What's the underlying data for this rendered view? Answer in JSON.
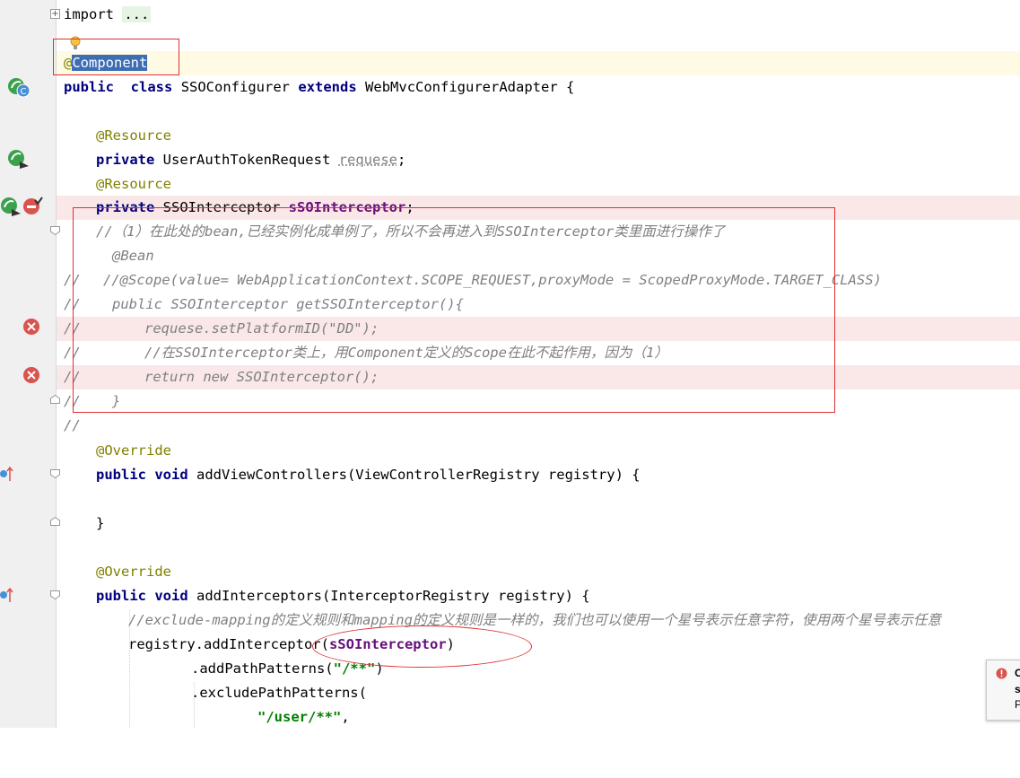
{
  "editor": {
    "lines": {
      "import_kw": "import",
      "import_fold": "...",
      "component_at": "@",
      "component_name": "Component",
      "class_kw1": "public",
      "class_kw2": "class",
      "class_name": "SSOConfigurer",
      "extends_kw": "extends",
      "parent": "WebMvcConfigurerAdapter {",
      "resource1": "@Resource",
      "private1": "private",
      "type1": "UserAuthTokenRequest",
      "field1": "requese",
      "semi1": ";",
      "resource2": "@Resource",
      "private2": "private",
      "type2": "SSOInterceptor",
      "field2": "sSOInterceptor",
      "semi2": ";",
      "c1": "//（1）在此处的bean,已经实例化成单例了，所以不会再进入到SSOInterceptor类里面进行操作了",
      "c2": "@Bean",
      "c3": "//@Scope(value= WebApplicationContext.SCOPE_REQUEST,proxyMode = ScopedProxyMode.TARGET_CLASS)",
      "c4": "public SSOInterceptor getSSOInterceptor(){",
      "c5": "requese.setPlatformID(\"DD\");",
      "c6": "//在SSOInterceptor类上，用Component定义的Scope在此不起作用，因为（1）",
      "c7": "return new SSOInterceptor();",
      "c8": "}",
      "lc": "//",
      "override1": "@Override",
      "m1_kw": "public void",
      "m1_rest": "addViewControllers(ViewControllerRegistry registry) {",
      "close1": "}",
      "override2": "@Override",
      "m2_kw": "public void",
      "m2_rest": "addInterceptors(InterceptorRegistry registry) {",
      "c9": "//exclude-mapping的定义规则和mapping的定义规则是一样的，我们也可以使用一个星号表示任意字符，使用两个星号表示任意",
      "reg": "registry.addInterceptor(",
      "reg_field": "sSOInterceptor",
      "reg_close": ")",
      "add_path": ".addPathPatterns(",
      "add_path_str": "\"/**\"",
      "add_path_close": ")",
      "exclude": ".excludePathPatterns(",
      "exclude_str": "\"/user/**\"",
      "exclude_comma": ","
    }
  },
  "notification": {
    "line1": "C",
    "line2": "s",
    "line3": "P"
  },
  "colors": {
    "keyword": "#000080",
    "annotation": "#808000",
    "field": "#660e7a",
    "comment": "#808080",
    "string": "#008000",
    "annotation_box": "#e03030"
  }
}
